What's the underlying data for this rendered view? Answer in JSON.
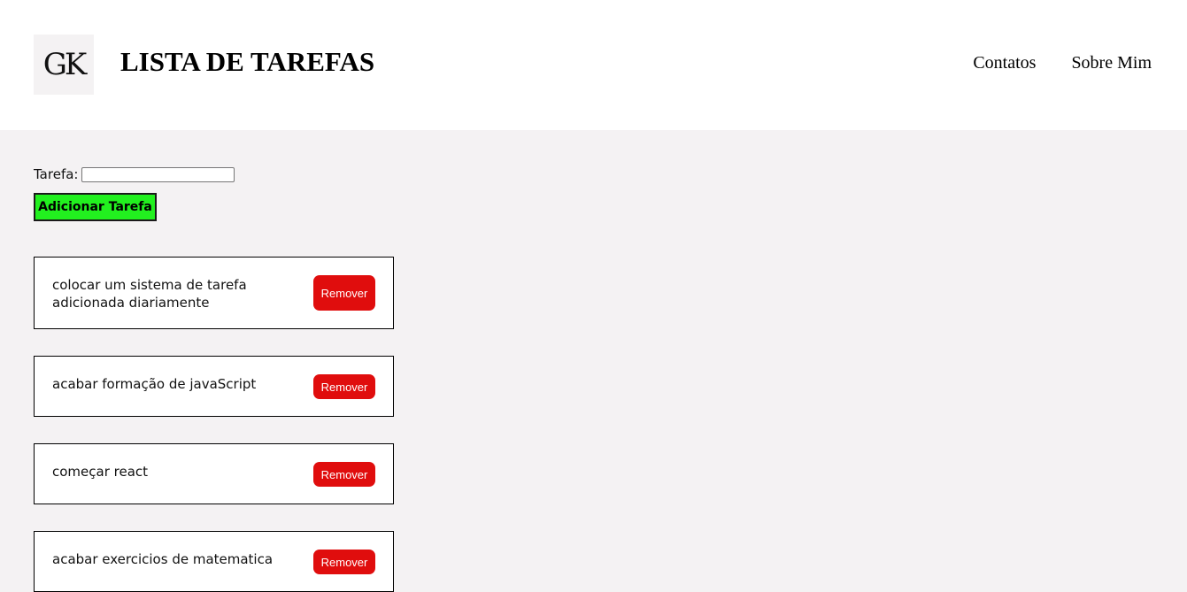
{
  "header": {
    "logo_text": "GK",
    "title": "LISTA DE TAREFAS",
    "nav": [
      "Contatos",
      "Sobre Mim"
    ]
  },
  "form": {
    "label": "Tarefa:",
    "input_value": "",
    "add_button": "Adicionar Tarefa"
  },
  "tasks": [
    {
      "text": "colocar um sistema de tarefa adicionada diariamente",
      "remove_label": "Remover"
    },
    {
      "text": "acabar formação de javaScript",
      "remove_label": "Remover"
    },
    {
      "text": "começar react",
      "remove_label": "Remover"
    },
    {
      "text": "acabar exercicios de matematica",
      "remove_label": "Remover"
    }
  ],
  "colors": {
    "add_button_bg": "#22f01f",
    "remove_button_bg": "#e00d0d",
    "page_bg": "#f4f2f3"
  }
}
